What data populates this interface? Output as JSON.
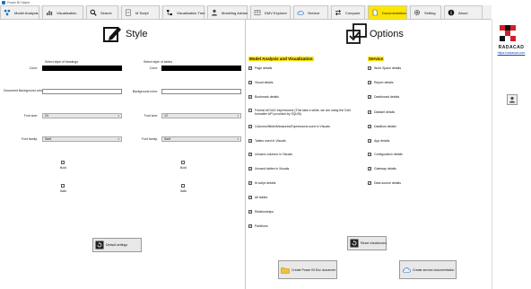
{
  "window": {
    "title": "Power BI Helper"
  },
  "toolbar": {
    "tabs": [
      {
        "label": "Model Analysis",
        "icon": "network-icon",
        "active": false
      },
      {
        "label": "Visualization",
        "icon": "chart-icon",
        "active": false
      },
      {
        "label": "Search",
        "icon": "search-icon",
        "active": false
      },
      {
        "label": "M Script",
        "icon": "m-script-icon",
        "active": false
      },
      {
        "label": "Visualization Tree",
        "icon": "tree-icon",
        "active": false
      },
      {
        "label": "Modeling Advise",
        "icon": "advisor-icon",
        "active": false
      },
      {
        "label": "DMV Explorer",
        "icon": "table-icon",
        "active": false
      },
      {
        "label": "Service",
        "icon": "cloud-icon",
        "active": false
      },
      {
        "label": "Compare",
        "icon": "compare-icon",
        "active": false
      },
      {
        "label": "Documentation",
        "icon": "document-icon",
        "active": true
      },
      {
        "label": "Setting",
        "icon": "gear-icon",
        "active": false
      },
      {
        "label": "About",
        "icon": "info-icon",
        "active": false
      }
    ]
  },
  "style": {
    "title": "Style",
    "headings": {
      "caption": "Select style of headings",
      "color_label": "Color:",
      "background_label": "Document Background color:",
      "font_size_label": "Font size:",
      "font_size_value": "24",
      "font_family_label": "Font family:",
      "font_family_value": "Serif",
      "bold_label": "Bold",
      "italic_label": "Italic"
    },
    "tables": {
      "caption": "Select style of tables",
      "color_label": "Color:",
      "background_label": "Background color:",
      "font_size_label": "Font size:",
      "font_size_value": "12",
      "font_family_label": "Font family:",
      "font_family_value": "Serif",
      "bold_label": "Bold",
      "italic_label": "Italic"
    },
    "default_button": "Default settings"
  },
  "options": {
    "title": "Options",
    "model_header": "Model Analysis and Visualization",
    "model_items": [
      {
        "label": "Page details",
        "checked": true
      },
      {
        "label": "Visual details",
        "checked": true
      },
      {
        "label": "Bookmark details",
        "checked": true
      },
      {
        "label": "Format all DAX expressions (This take a while, we are using the DAX",
        "label2": "formatter API provided by SQLBI)",
        "checked": false
      },
      {
        "label": "Columns/fields/Measures/Expressions used in Visuals",
        "checked": true
      },
      {
        "label": "Tables used in Visuals",
        "checked": true
      },
      {
        "label": "Unused columns in Visuals",
        "checked": true
      },
      {
        "label": "Unused tables in Visuals",
        "checked": true
      },
      {
        "label": "M script details",
        "checked": true
      },
      {
        "label": "All tables",
        "checked": true
      },
      {
        "label": "Relationships",
        "checked": true
      },
      {
        "label": "Partitions",
        "checked": true
      }
    ],
    "service_header": "Service",
    "service_items": [
      {
        "label": "Work Space details",
        "checked": true
      },
      {
        "label": "Report details",
        "checked": true
      },
      {
        "label": "Dashboard details",
        "checked": true
      },
      {
        "label": "Dataset details",
        "checked": true
      },
      {
        "label": "Dataflow details",
        "checked": true
      },
      {
        "label": "App details",
        "checked": true
      },
      {
        "label": "Configuration details",
        "checked": true
      },
      {
        "label": "Gateway details",
        "checked": true
      },
      {
        "label": "Data source details",
        "checked": true
      }
    ],
    "reset_button": "Reset checkboxes",
    "create_pbi_button": "Create Power BI Doc document",
    "create_service_button": "Create service documentation"
  },
  "brand": {
    "name": "RADACAD",
    "url": "https://radacad.com"
  }
}
